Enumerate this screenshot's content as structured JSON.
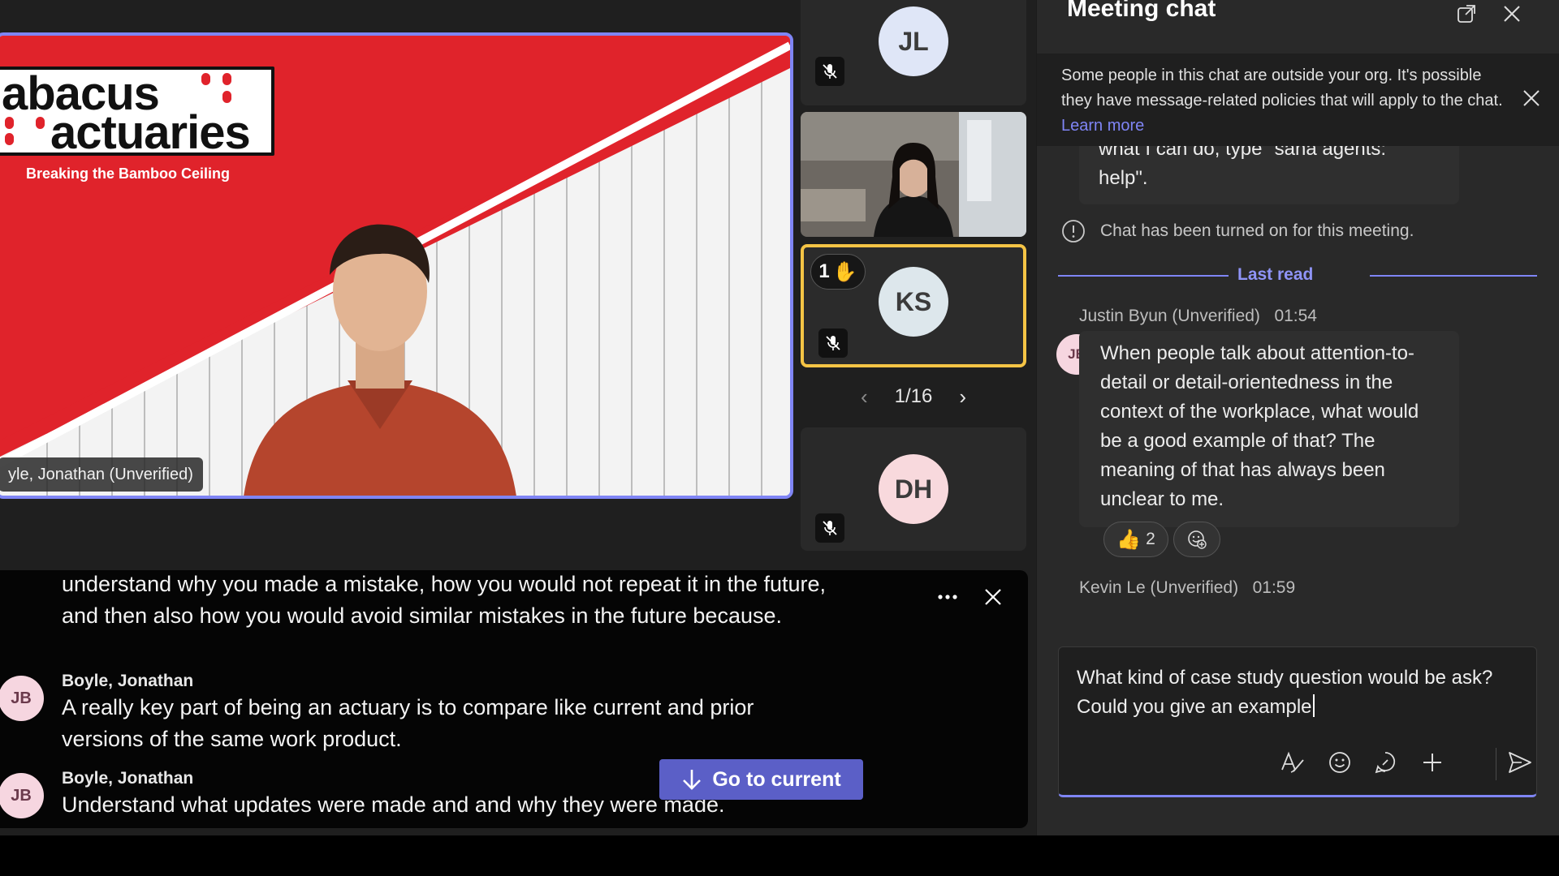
{
  "stage": {
    "slide": {
      "logo_line1": "abacus",
      "logo_line2": "actuaries",
      "tagline": "Breaking the Bamboo Ceiling"
    },
    "presenter_name": "yle, Jonathan (Unverified)"
  },
  "tiles": [
    {
      "initials": "JL",
      "avatar_color": "#dfe6f7",
      "muted": true
    },
    {
      "type": "video"
    },
    {
      "initials": "KS",
      "avatar_color": "#dde7ec",
      "muted": true,
      "raised_hand_count": "1",
      "raised_hand_emoji": "✋"
    },
    {
      "initials": "DH",
      "avatar_color": "#f8d9dd",
      "muted": true
    }
  ],
  "pager": {
    "label": "1/16"
  },
  "captions": {
    "continuation": "understand why you made a mistake, how you would not repeat it in the future, and then also how you would avoid similar mistakes in the future because.",
    "entries": [
      {
        "initials": "JB",
        "speaker": "Boyle, Jonathan",
        "text": "A really key part of being an actuary is to compare like current and prior versions of the same work product."
      },
      {
        "initials": "JB",
        "speaker": "Boyle, Jonathan",
        "text": "Understand what updates were made and and why they were made."
      }
    ],
    "go_to_current": "Go to current"
  },
  "chat": {
    "title": "Meeting chat",
    "banner": {
      "text": "Some people in this chat are outside your org. It's possible they have message-related policies that will apply to the chat.",
      "link": "Learn more"
    },
    "partial_message": "what I can do, type \"sana agents: help\".",
    "system_message": "Chat has been turned on for this meeting.",
    "last_read": "Last read",
    "messages": [
      {
        "author": "Justin Byun (Unverified)",
        "time": "01:54",
        "initials": "JB",
        "text": "When people talk about attention-to-detail or detail-orientedness in the context of the workplace, what would be a good example of that? The meaning of that has always been unclear to me.",
        "reaction_emoji": "👍",
        "reaction_count": "2"
      },
      {
        "author": "Kevin Le (Unverified)",
        "time": "01:59"
      }
    ],
    "compose": {
      "text": "What kind of case study question would be ask? Could you give an example"
    }
  },
  "colors": {
    "accent": "#7f85f5",
    "button": "#5b5fc7",
    "raise_hand_border": "#f5c445",
    "slide_red": "#e0232b"
  }
}
